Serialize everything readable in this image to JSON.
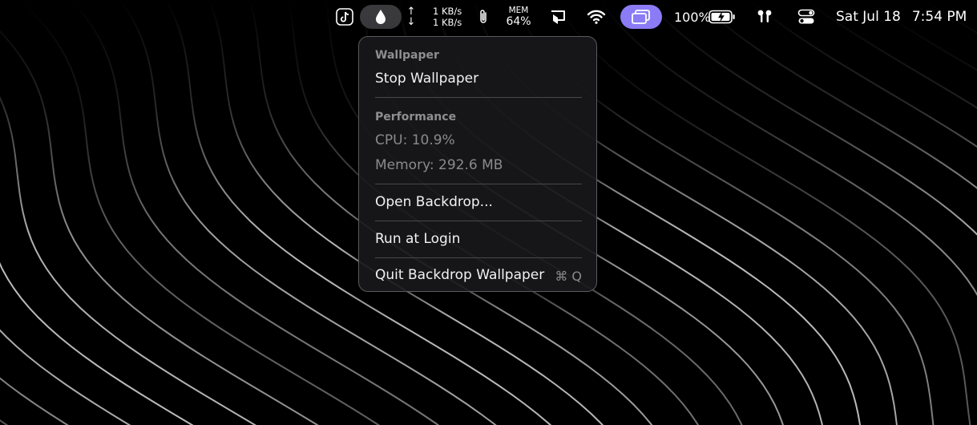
{
  "menubar": {
    "network": {
      "up": "1 KB/s",
      "down": "1 KB/s",
      "up_arrow": "↑",
      "down_arrow": "↓"
    },
    "memory": {
      "label": "MEM",
      "value": "64%"
    },
    "battery_percent": "100%",
    "clock": {
      "date": "Sat Jul 18",
      "time": "7:54 PM"
    },
    "icons": [
      "tiktok-icon",
      "droplet-icon",
      "paperclip-icon",
      "display-mirror-icon",
      "wifi-icon",
      "screens-icon",
      "battery-charging-icon",
      "airpods-icon",
      "control-center-icon"
    ]
  },
  "menu": {
    "section_wallpaper": "Wallpaper",
    "stop_wallpaper": "Stop Wallpaper",
    "section_performance": "Performance",
    "cpu": "CPU: 10.9%",
    "memory": "Memory: 292.6 MB",
    "open_backdrop": "Open Backdrop...",
    "run_at_login": "Run at Login",
    "quit": "Quit Backdrop Wallpaper",
    "quit_shortcut": "⌘ Q"
  },
  "colors": {
    "background": "#000000",
    "menu_bg": "#18181a",
    "menu_border": "#5a5a5e",
    "accent_purple": "#8b7cf6",
    "active_pill": "#3a3a3c",
    "disabled_text": "#8a8a8e"
  }
}
